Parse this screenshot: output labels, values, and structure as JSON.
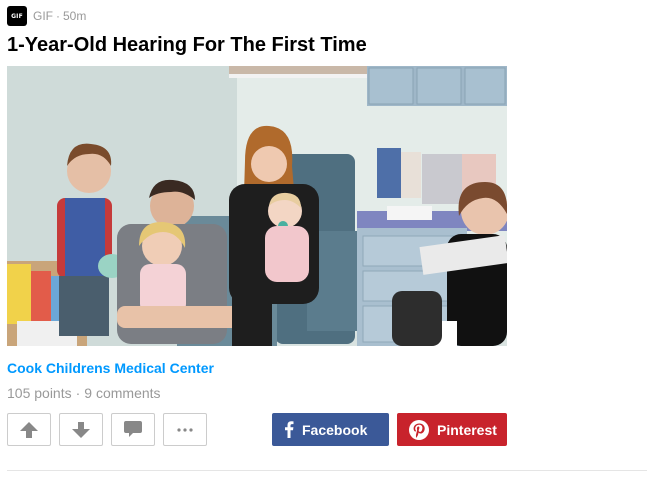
{
  "post": {
    "section_icon_text": "GIF",
    "section": "GIF",
    "meta_separator": "·",
    "age": "50m",
    "title": "1-Year-Old Hearing For The First Time",
    "attribution": "Cook Childrens Medical Center",
    "points": "105 points",
    "stats_separator": "·",
    "comments": "9 comments"
  },
  "actions": {
    "upvote_icon": "arrow-up-icon",
    "downvote_icon": "arrow-down-icon",
    "comment_icon": "comment-icon",
    "more_icon": "more-icon",
    "facebook_label": "Facebook",
    "pinterest_label": "Pinterest"
  },
  "colors": {
    "facebook": "#3b5998",
    "pinterest": "#c8232c",
    "link": "#0099ff",
    "meta_text": "#999999"
  }
}
